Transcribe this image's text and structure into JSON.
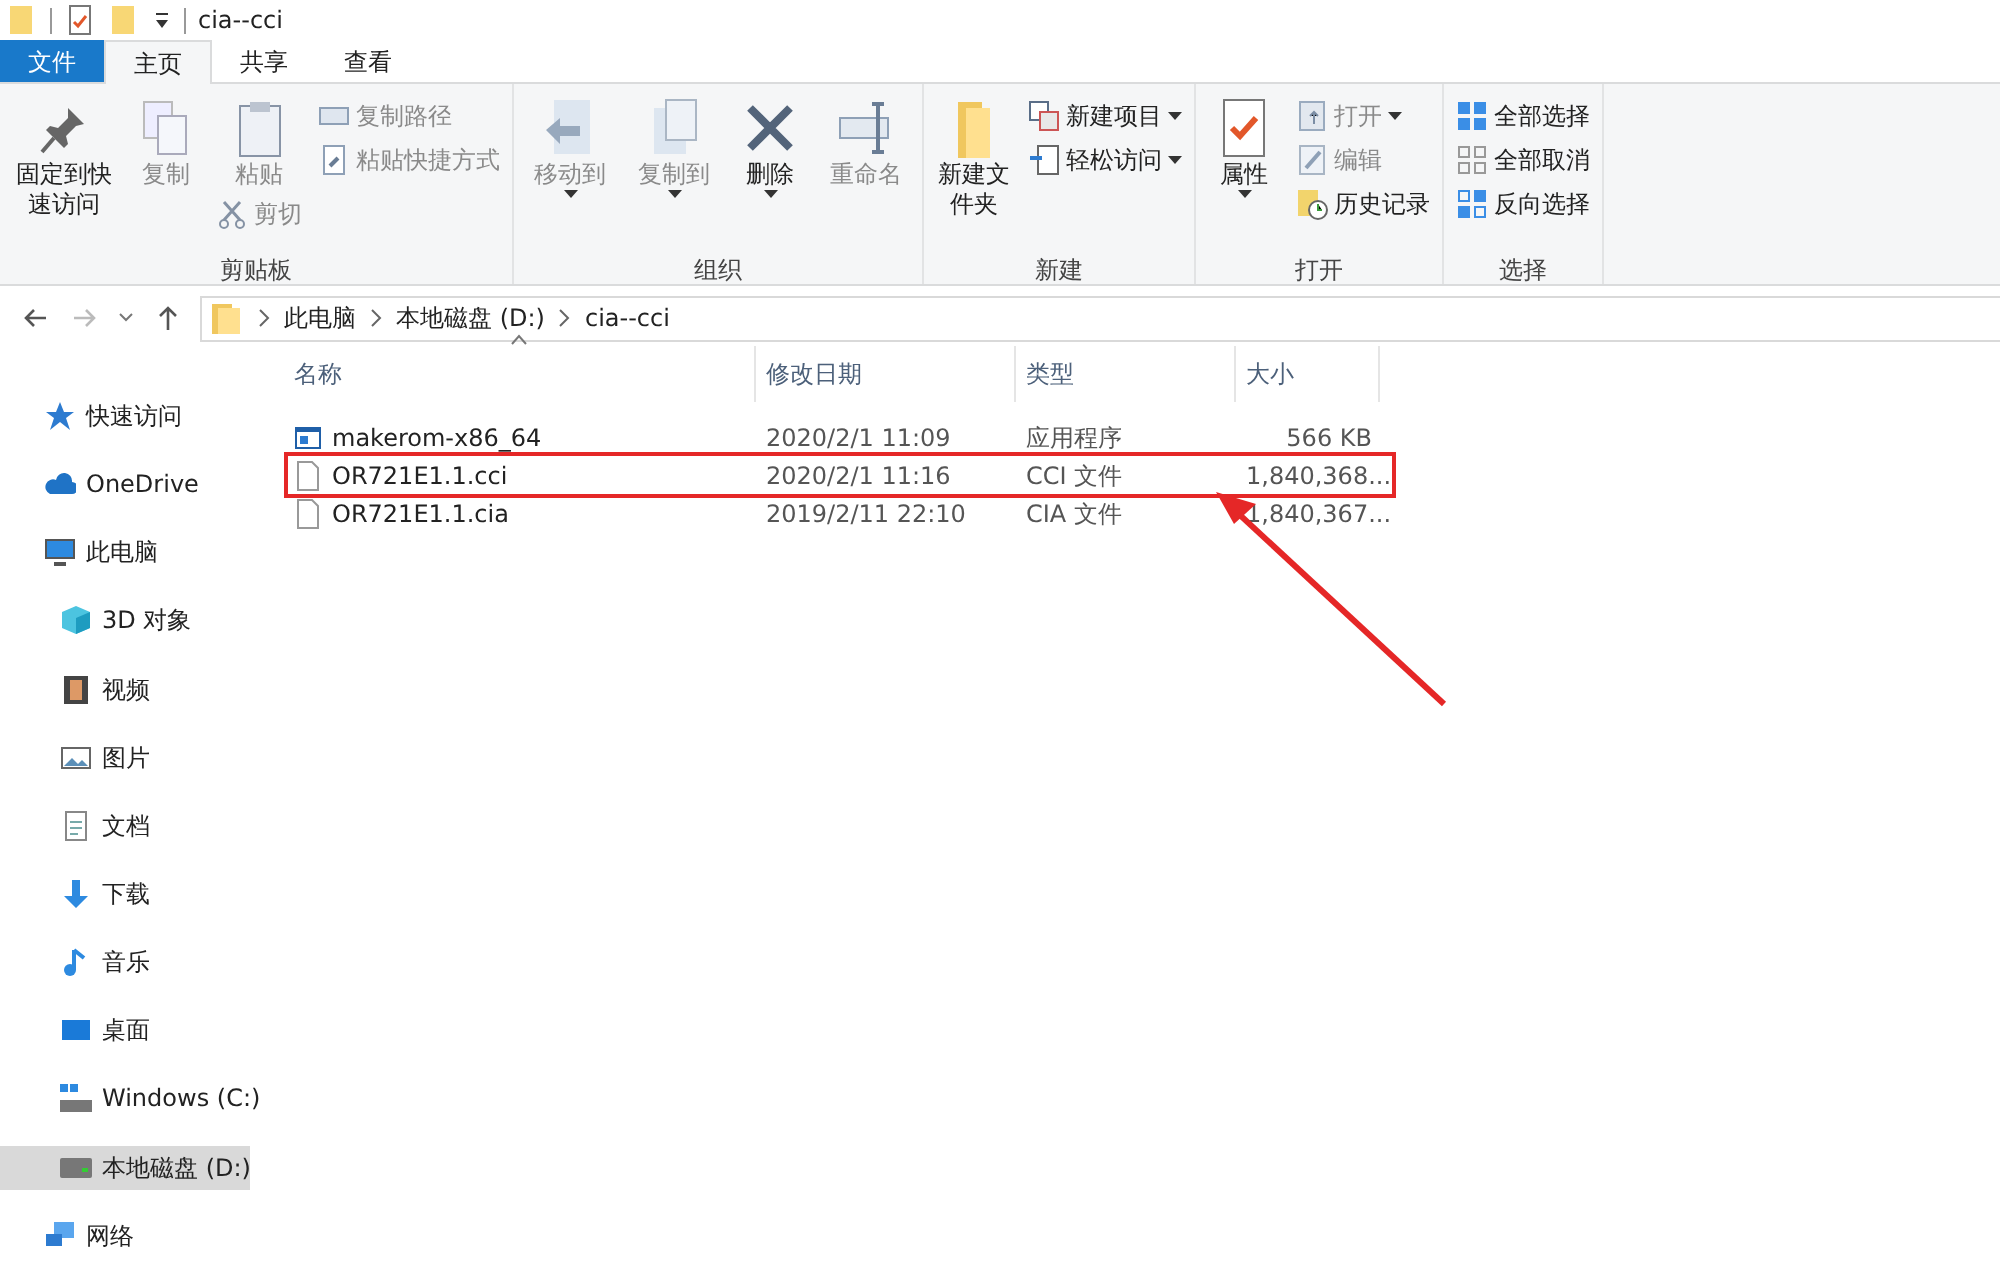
{
  "window": {
    "title": "cia--cci"
  },
  "tabs": [
    {
      "label": "文件",
      "kind": "file",
      "selected": false
    },
    {
      "label": "主页",
      "kind": "tab",
      "selected": true
    },
    {
      "label": "共享",
      "kind": "tab",
      "selected": false
    },
    {
      "label": "查看",
      "kind": "tab",
      "selected": false
    }
  ],
  "ribbon": [
    {
      "label": "剪贴板",
      "items": [
        {
          "kind": "large",
          "label": "固定到快速访问",
          "disabled": false,
          "dropdown": false
        },
        {
          "kind": "large",
          "label": "复制",
          "disabled": true,
          "dropdown": false
        },
        {
          "kind": "large",
          "label": "粘贴",
          "disabled": true,
          "dropdown": false,
          "below": {
            "label": "剪切",
            "disabled": true
          }
        },
        {
          "kind": "column",
          "items": [
            {
              "label": "复制路径",
              "disabled": true,
              "dropdown": false
            },
            {
              "label": "粘贴快捷方式",
              "disabled": true,
              "dropdown": false
            }
          ]
        }
      ]
    },
    {
      "label": "组织",
      "items": [
        {
          "kind": "large",
          "label": "移动到",
          "disabled": true,
          "dropdown": true
        },
        {
          "kind": "large",
          "label": "复制到",
          "disabled": true,
          "dropdown": true
        },
        {
          "kind": "large",
          "label": "删除",
          "disabled": false,
          "dropdown": true
        },
        {
          "kind": "large",
          "label": "重命名",
          "disabled": true,
          "dropdown": false
        }
      ]
    },
    {
      "label": "新建",
      "items": [
        {
          "kind": "large",
          "label": "新建文件夹",
          "disabled": false,
          "dropdown": false
        },
        {
          "kind": "column",
          "items": [
            {
              "label": "新建项目",
              "disabled": false,
              "dropdown": true
            },
            {
              "label": "轻松访问",
              "disabled": false,
              "dropdown": true
            }
          ]
        }
      ]
    },
    {
      "label": "打开",
      "items": [
        {
          "kind": "large",
          "label": "属性",
          "disabled": false,
          "dropdown": true
        },
        {
          "kind": "column",
          "items": [
            {
              "label": "打开",
              "disabled": true,
              "dropdown": true
            },
            {
              "label": "编辑",
              "disabled": true,
              "dropdown": false
            },
            {
              "label": "历史记录",
              "disabled": false,
              "dropdown": false
            }
          ]
        }
      ]
    },
    {
      "label": "选择",
      "items": [
        {
          "kind": "column",
          "items": [
            {
              "label": "全部选择",
              "disabled": false,
              "dropdown": false
            },
            {
              "label": "全部取消",
              "disabled": false,
              "dropdown": false
            },
            {
              "label": "反向选择",
              "disabled": false,
              "dropdown": false
            }
          ]
        }
      ]
    }
  ],
  "address": {
    "breadcrumbs": [
      "此电脑",
      "本地磁盘 (D:)",
      "cia--cci"
    ]
  },
  "sidebar": {
    "items": [
      {
        "label": "快速访问",
        "selected": false
      },
      {
        "label": "OneDrive",
        "selected": false
      },
      {
        "label": "此电脑",
        "selected": false,
        "children": [
          {
            "label": "3D 对象",
            "selected": false
          },
          {
            "label": "视频",
            "selected": false
          },
          {
            "label": "图片",
            "selected": false
          },
          {
            "label": "文档",
            "selected": false
          },
          {
            "label": "下载",
            "selected": false
          },
          {
            "label": "音乐",
            "selected": false
          },
          {
            "label": "桌面",
            "selected": false
          },
          {
            "label": "Windows (C:)",
            "selected": false
          },
          {
            "label": "本地磁盘 (D:)",
            "selected": true
          }
        ]
      },
      {
        "label": "网络",
        "selected": false
      }
    ]
  },
  "table": {
    "columns": [
      "名称",
      "修改日期",
      "类型",
      "大小"
    ],
    "rows": [
      {
        "name": "makerom-x86_64",
        "kind": "app",
        "date": "2020/2/1 11:09",
        "type": "应用程序",
        "size": "566 KB",
        "highlighted": false
      },
      {
        "name": "OR721E1.1.cci",
        "kind": "file",
        "date": "2020/2/1 11:16",
        "type": "CCI 文件",
        "size": "1,840,368...",
        "highlighted": true
      },
      {
        "name": "OR721E1.1.cia",
        "kind": "file",
        "date": "2019/2/11 22:10",
        "type": "CIA 文件",
        "size": "1,840,367...",
        "highlighted": false
      }
    ]
  }
}
